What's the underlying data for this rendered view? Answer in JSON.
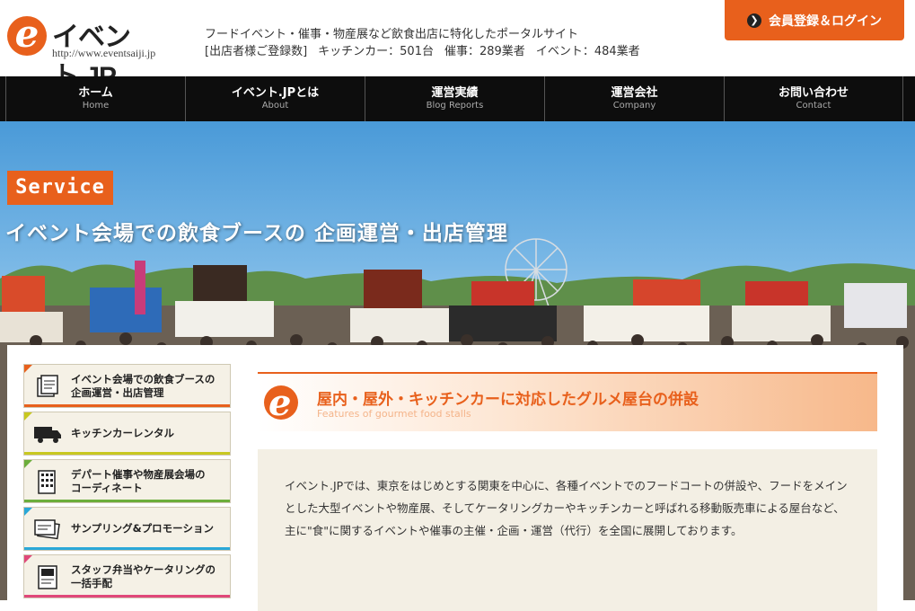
{
  "header": {
    "logo_name": "イベント.JP",
    "logo_url": "http://www.eventsaiji.jp",
    "tagline": "フードイベント・催事・物産展など飲食出店に特化したポータルサイト",
    "stats_prefix": "[出店者様ご登録数]",
    "stat_kitchen_car": "キッチンカー：501台",
    "stat_saiji": "催事：289業者",
    "stat_event": "イベント：484業者",
    "member_button": "会員登録＆ログイン"
  },
  "nav": [
    {
      "ja": "ホーム",
      "en": "Home"
    },
    {
      "ja": "イベント.JPとは",
      "en": "About"
    },
    {
      "ja": "運営実績",
      "en": "Blog Reports"
    },
    {
      "ja": "運営会社",
      "en": "Company"
    },
    {
      "ja": "お問い合わせ",
      "en": "Contact"
    }
  ],
  "hero": {
    "badge": "Service",
    "title": "イベント会場での飲食ブースの 企画運営・出店管理"
  },
  "sidebar": {
    "items": [
      {
        "label": "イベント会場での飲食ブースの\n企画運営・出店管理",
        "color": "#e8601c",
        "icon": "document-icon"
      },
      {
        "label": "キッチンカーレンタル",
        "color": "#c8c820",
        "icon": "truck-icon"
      },
      {
        "label": "デパート催事や物産展会場の\nコーディネート",
        "color": "#6cae3c",
        "icon": "building-icon"
      },
      {
        "label": "サンプリング&プロモーション",
        "color": "#2aa8d8",
        "icon": "sample-card-icon"
      },
      {
        "label": "スタッフ弁当やケータリングの\n一括手配",
        "color": "#e0487a",
        "icon": "menu-icon"
      }
    ]
  },
  "main": {
    "heading_ja": "屋内・屋外・キッチンカーに対応したグルメ屋台の併設",
    "heading_en": "Features of gourmet food stalls",
    "intro": "イベント.JPでは、東京をはじめとする関東を中心に、各種イベントでのフードコートの併設や、フードをメインとした大型イベントや物産展、そしてケータリングカーやキッチンカーと呼ばれる移動販売車による屋台など、主に\"食\"に関するイベントや催事の主催・企画・運営（代行）を全国に展開しております。"
  },
  "colors": {
    "accent": "#e8601c",
    "nav_bg": "#0d0d0d"
  }
}
